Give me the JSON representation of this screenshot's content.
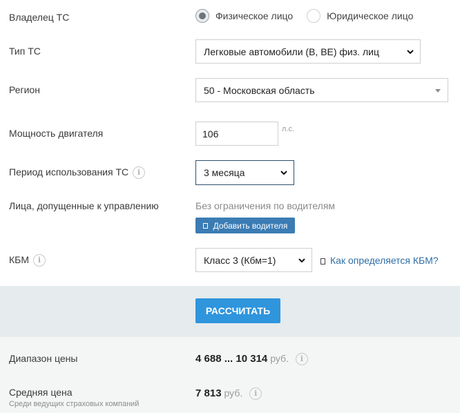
{
  "owner": {
    "label": "Владелец ТС",
    "options": [
      "Физическое лицо",
      "Юридическое лицо"
    ],
    "selected": "Физическое лицо"
  },
  "vehicle_type": {
    "label": "Тип ТС",
    "value": "Легковые автомобили (B, BE) физ. лиц"
  },
  "region": {
    "label": "Регион",
    "value": "50 - Московская область"
  },
  "engine_power": {
    "label": "Мощность двигателя",
    "value": "106",
    "unit": "л.с."
  },
  "usage_period": {
    "label": "Период использования ТС",
    "value": "3 месяца",
    "info_icon": "info-icon"
  },
  "drivers": {
    "label": "Лица, допущенные к управлению",
    "status": "Без ограничения по водителям",
    "add_button": "Добавить водителя"
  },
  "kbm": {
    "label": "КБМ",
    "value": "Класс 3 (Кбм=1)",
    "help_link": "Как определяется КБМ?"
  },
  "calculate_button": "РАССЧИТАТЬ",
  "results": {
    "range_label": "Диапазон цены",
    "range_value": "4 688 ... 10 314",
    "currency": "руб.",
    "avg_label": "Средняя цена",
    "avg_sub": "Среди ведущих страховых компаний",
    "avg_value": "7 813"
  },
  "colors": {
    "primary_button": "#2f95dd",
    "secondary_button": "#3b7cb4",
    "link": "#2f6ea5",
    "band": "#e6ebed"
  }
}
